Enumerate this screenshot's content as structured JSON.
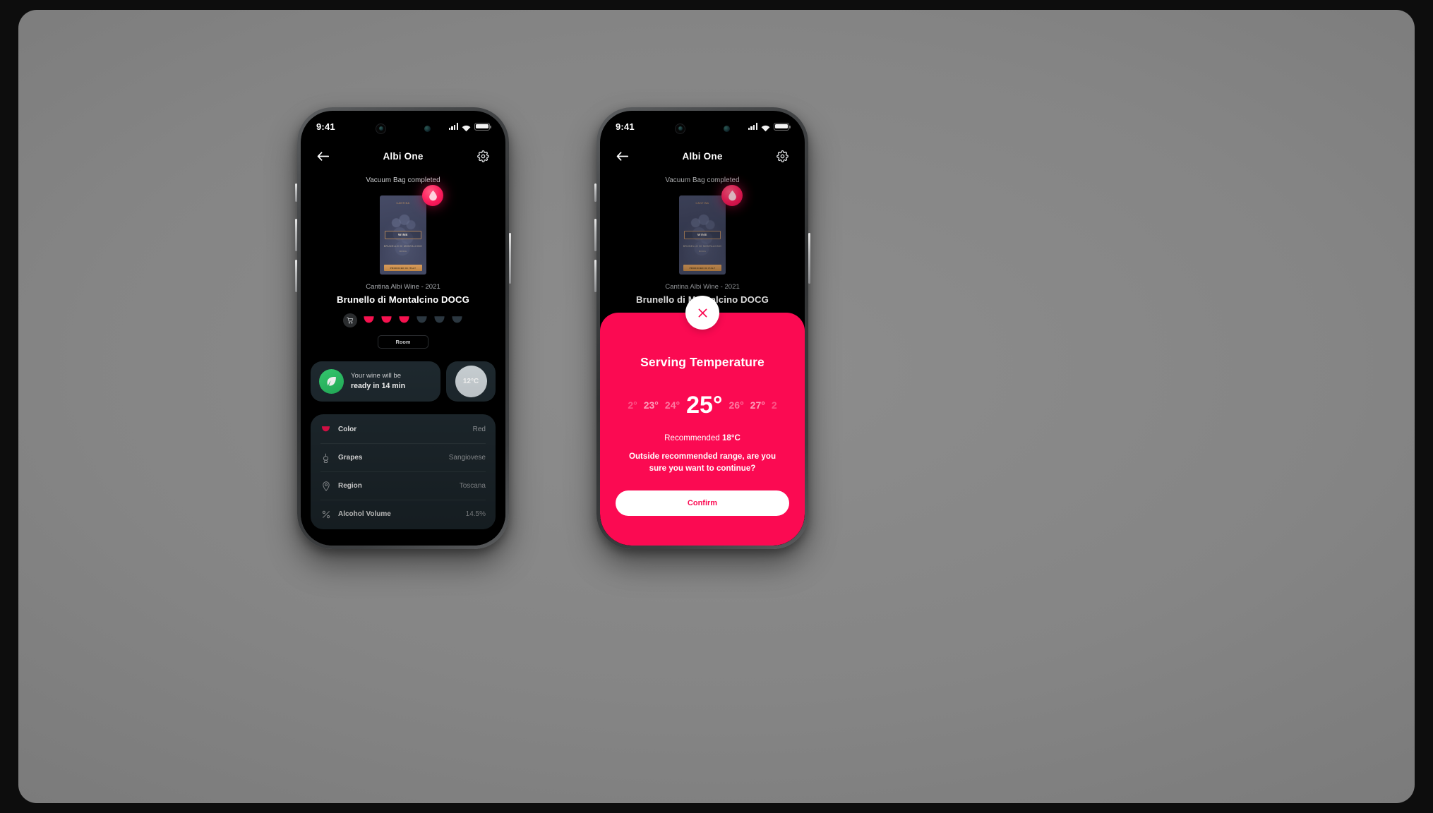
{
  "statusbar": {
    "time": "9:41",
    "signal_icon": "signal-bars-icon",
    "wifi_icon": "wifi-icon",
    "battery_icon": "battery-icon"
  },
  "navbar": {
    "back_icon": "back-arrow-icon",
    "title": "Albi One",
    "settings_icon": "gear-icon"
  },
  "screen": {
    "status_caption": "Vacuum Bag completed",
    "bottle": {
      "badge_icon": "wine-drop-icon",
      "label_top": "CANTINA",
      "label_name": "WINE",
      "label_sub1": "BRUNELLO DI MONTALCINO",
      "label_sub2": "DOCG",
      "label_footer": "PRODUCED IN ITALY"
    },
    "wine_vintage": "Cantina Albi Wine - 2021",
    "wine_name": "Brunello di Montalcino DOCG",
    "cart_icon": "cart-icon",
    "glasses_filled": 3,
    "glasses_total": 6,
    "room_badge": "Room",
    "ready_card": {
      "leaf_icon": "leaf-icon",
      "line1": "Your wine will be",
      "line2": "ready in 14 min"
    },
    "temperature_chip": "12°C",
    "details": [
      {
        "icon": "wine-glass-icon",
        "label": "Color",
        "value": "Red"
      },
      {
        "icon": "grapes-icon",
        "label": "Grapes",
        "value": "Sangiovese"
      },
      {
        "icon": "location-pin-icon",
        "label": "Region",
        "value": "Toscana"
      },
      {
        "icon": "percent-icon",
        "label": "Alcohol Volume",
        "value": "14.5%"
      }
    ]
  },
  "modal": {
    "close_icon": "close-x-icon",
    "title": "Serving Temperature",
    "picker": [
      {
        "label": "2°",
        "state": "edge"
      },
      {
        "label": "23°",
        "state": "near"
      },
      {
        "label": "24°",
        "state": "normal"
      },
      {
        "label": "25°",
        "state": "sel"
      },
      {
        "label": "26°",
        "state": "normal"
      },
      {
        "label": "27°",
        "state": "near"
      },
      {
        "label": "2",
        "state": "edge"
      }
    ],
    "selected_value": "25°",
    "recommended_prefix": "Recommended ",
    "recommended_value": "18°C",
    "warning": "Outside recommended range, are you sure you want to continue?",
    "confirm_label": "Confirm"
  },
  "colors": {
    "accent_pink": "#fb0a52",
    "card_dark": "#1f2a30",
    "green": "#24b85d",
    "screen_black": "#000000",
    "backdrop_gray": "#858585"
  }
}
